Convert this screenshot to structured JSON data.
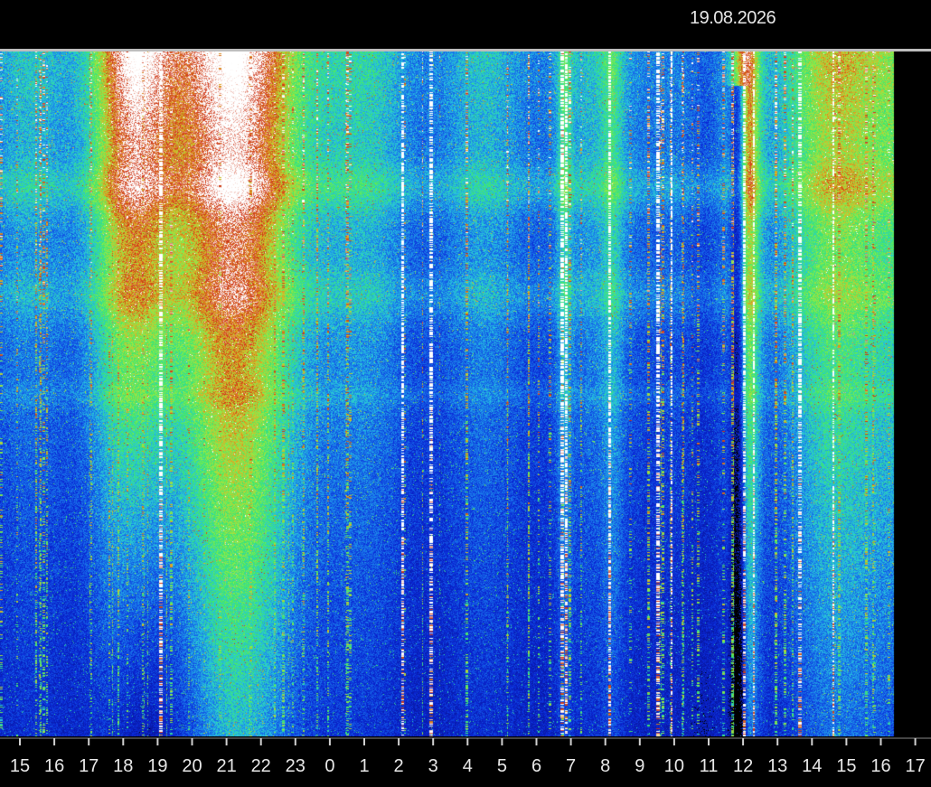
{
  "header": {
    "date": "19.08.2026"
  },
  "chart_data": {
    "type": "heatmap",
    "title": "",
    "xlabel": "",
    "ylabel": "",
    "date": "19.08.2026",
    "x_tick_labels": [
      "15",
      "16",
      "17",
      "18",
      "19",
      "20",
      "21",
      "22",
      "23",
      "0",
      "1",
      "2",
      "3",
      "4",
      "5",
      "6",
      "7",
      "8",
      "9",
      "10",
      "11",
      "12",
      "13",
      "14",
      "15",
      "16",
      "17"
    ],
    "x_range_hours": [
      15,
      17
    ],
    "data_ends_at_tick": "16.3",
    "colormap": [
      "#0a1cbe",
      "#2aa0e8",
      "#38e070",
      "#e0c020",
      "#c83010",
      "#ffffff"
    ],
    "activity_bursts": [
      {
        "start": "17.2",
        "end": "19.5",
        "level": "very-high"
      },
      {
        "start": "19.6",
        "end": "22.5",
        "level": "high"
      },
      {
        "start": "6.8",
        "end": "7.0",
        "level": "high"
      },
      {
        "start": "12.0",
        "end": "12.6",
        "level": "very-high"
      },
      {
        "start": "13.0",
        "end": "16.3",
        "level": "medium-high"
      }
    ]
  }
}
